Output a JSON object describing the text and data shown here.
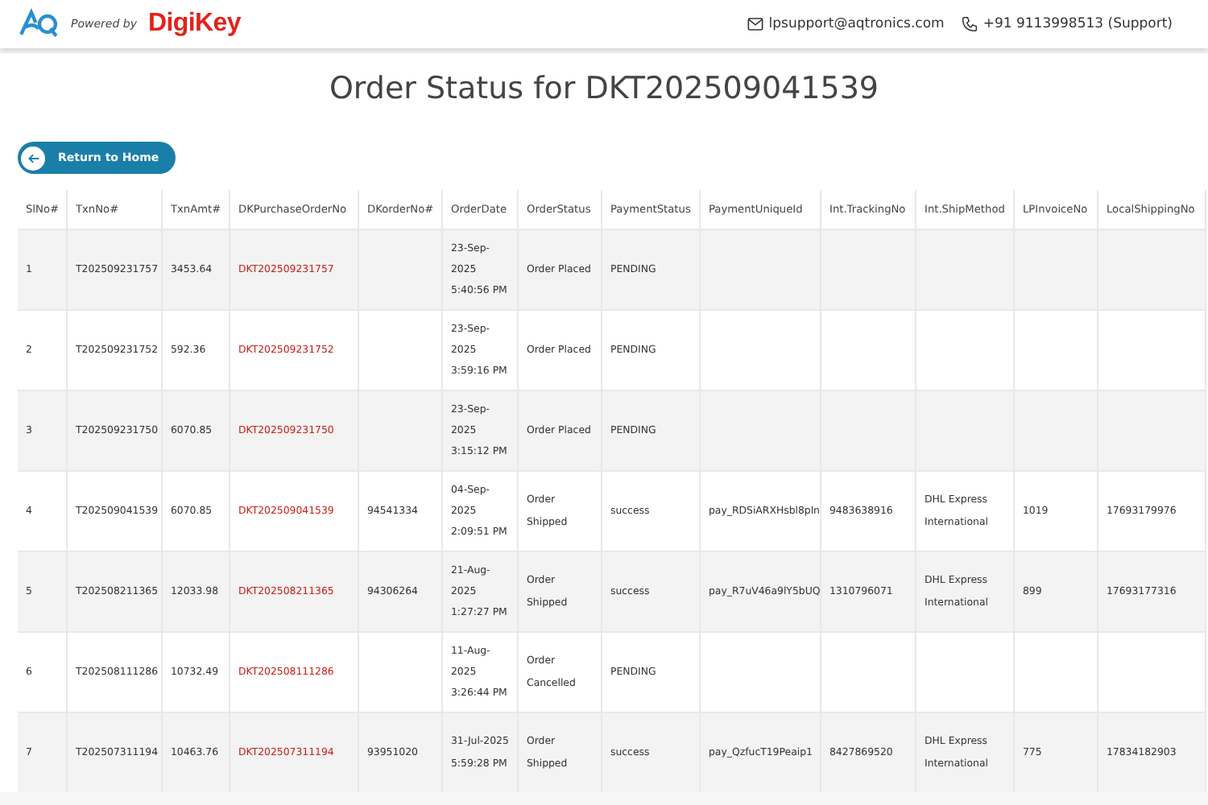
{
  "header": {
    "powered_by": "Powered by",
    "brand": "DigiKey",
    "email": "lpsupport@aqtronics.com",
    "phone": "+91 9113998513 (Support)"
  },
  "title": "Order Status for DKT202509041539",
  "return_button": "Return to Home",
  "table": {
    "columns": [
      {
        "label": "SlNo#",
        "kind": "text"
      },
      {
        "label": "TxnNo#",
        "kind": "text"
      },
      {
        "label": "TxnAmt#",
        "kind": "text"
      },
      {
        "label": "DKPurchaseOrderNo",
        "kind": "link"
      },
      {
        "label": "DKorderNo#",
        "kind": "text"
      },
      {
        "label": "OrderDate",
        "kind": "text"
      },
      {
        "label": "OrderStatus",
        "kind": "text"
      },
      {
        "label": "PaymentStatus",
        "kind": "text"
      },
      {
        "label": "PaymentUniqueId",
        "kind": "text"
      },
      {
        "label": "Int.TrackingNo",
        "kind": "text"
      },
      {
        "label": "Int.ShipMethod",
        "kind": "text"
      },
      {
        "label": "LPInvoiceNo",
        "kind": "text"
      },
      {
        "label": "LocalShippingNo",
        "kind": "text"
      }
    ],
    "rows": [
      [
        "1",
        "T202509231757",
        "3453.64",
        "DKT202509231757",
        null,
        "23-Sep-2025 5:40:56 PM",
        "Order Placed",
        "PENDING",
        null,
        null,
        null,
        null,
        null
      ],
      [
        "2",
        "T202509231752",
        "592.36",
        "DKT202509231752",
        null,
        "23-Sep-2025 3:59:16 PM",
        "Order Placed",
        "PENDING",
        null,
        null,
        null,
        null,
        null
      ],
      [
        "3",
        "T202509231750",
        "6070.85",
        "DKT202509231750",
        null,
        "23-Sep-2025 3:15:12 PM",
        "Order Placed",
        "PENDING",
        null,
        null,
        null,
        null,
        null
      ],
      [
        "4",
        "T202509041539",
        "6070.85",
        "DKT202509041539",
        "94541334",
        "04-Sep-2025 2:09:51 PM",
        "Order Shipped",
        "success",
        "pay_RDSiARXHsbl8pln",
        "9483638916",
        "DHL Express International",
        "1019",
        "17693179976"
      ],
      [
        "5",
        "T202508211365",
        "12033.98",
        "DKT202508211365",
        "94306264",
        "21-Aug-2025 1:27:27 PM",
        "Order Shipped",
        "success",
        "pay_R7uV46a9lY5bUQ",
        "1310796071",
        "DHL Express International",
        "899",
        "17693177316"
      ],
      [
        "6",
        "T202508111286",
        "10732.49",
        "DKT202508111286",
        null,
        "11-Aug-2025 3:26:44 PM",
        "Order Cancelled",
        "PENDING",
        null,
        null,
        null,
        null,
        null
      ],
      [
        "7",
        "T202507311194",
        "10463.76",
        "DKT202507311194",
        "93951020",
        "31-Jul-2025 5:59:28 PM",
        "Order Shipped",
        "success",
        "pay_QzfucT19Peaip1",
        "8427869520",
        "DHL Express International",
        "775",
        "17834182903"
      ]
    ]
  }
}
